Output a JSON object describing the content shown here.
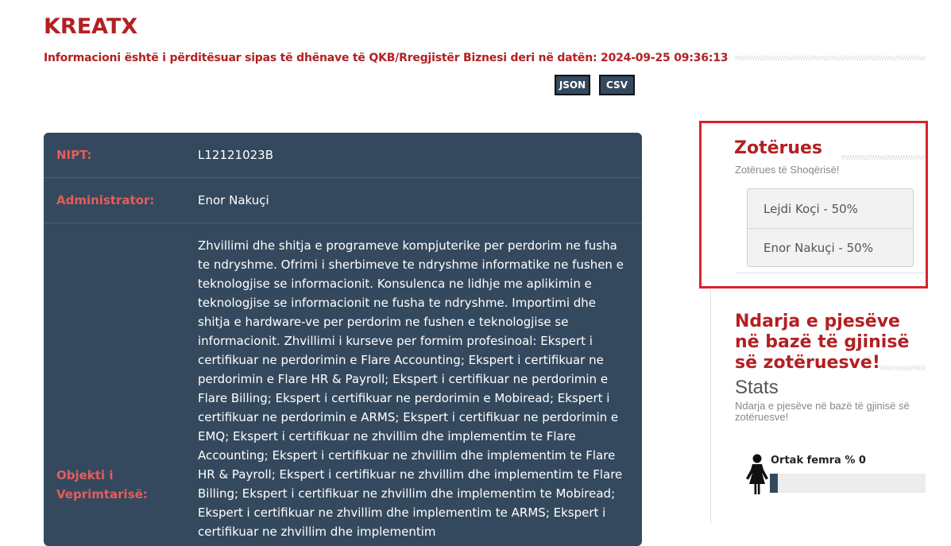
{
  "header": {
    "company_name": "KREATX",
    "update_info": "Informacioni është i përditësuar sipas të dhënave të QKB/Rregjistër Biznesi deri në datën: 2024-09-25 09:36:13"
  },
  "export": {
    "json_label": "JSON",
    "csv_label": "CSV"
  },
  "info": {
    "nipt_label": "NIPT:",
    "nipt_value": "L12121023B",
    "admin_label": "Administrator:",
    "admin_value": "Enor Nakuçi",
    "object_label": "Objekti i Veprimtarisë:",
    "object_value": "Zhvillimi dhe shitja e programeve kompjuterike per perdorim ne fusha te ndryshme. Ofrimi i sherbimeve te ndryshme informatike ne fushen e teknologjise se informacionit. Konsulenca ne lidhje me aplikimin e teknologjise se informacionit ne fusha te ndryshme. Importimi dhe shitja e hardware-ve per perdorim ne fushen e teknologjise se informacionit. Zhvillimi i kurseve per formim profesinoal: Ekspert i certifikuar ne perdorimin e Flare Accounting; Ekspert i certifikuar ne perdorimin e Flare HR & Payroll; Ekspert i certifikuar ne perdorimin e Flare Billing; Ekspert i certifikuar ne perdorimin e Mobiread; Ekspert i certifikuar ne perdorimin e ARMS; Ekspert i certifikuar ne perdorimin e EMQ; Ekspert i certifikuar ne zhvillim dhe implementim te Flare Accounting; Ekspert i certifikuar ne zhvillim dhe implementim te Flare HR & Payroll; Ekspert i certifikuar ne zhvillim dhe implementim te Flare Billing; Ekspert i certifikuar ne zhvillim dhe implementim te Mobiread; Ekspert i certifikuar ne zhvillim dhe implementim te ARMS; Ekspert i certifikuar ne zhvillim dhe implementim"
  },
  "owners": {
    "title": "Zotërues",
    "subtitle": "Zotërues të Shoqërisë!",
    "items": [
      {
        "label": "Lejdi Koçi - 50%"
      },
      {
        "label": "Enor Nakuçi - 50%"
      }
    ]
  },
  "stats": {
    "title": "Ndarja e pjesëve në bazë të gjinisë së zotëruesve!",
    "heading": "Stats",
    "subtitle": "Ndarja e pjesëve në bazë të gjinisë së zotëruesve!",
    "female_label": "Ortak femra % 0",
    "female_percent": 0,
    "female_icon": "female-person-icon",
    "accent_color": "#34495e"
  },
  "colors": {
    "brand_red": "#b32022",
    "label_red": "#e35d5b",
    "card_bg": "#34495e",
    "highlight_border": "#d9232d"
  }
}
